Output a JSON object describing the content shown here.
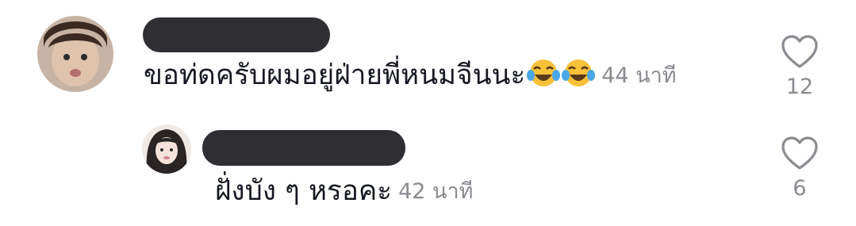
{
  "comments": [
    {
      "text": "ขอท่ดครับผมอยู่ฝ่ายพี่หนมจีนนะ",
      "emoji": "face-with-tears-of-joy x2",
      "time": "44 นาที",
      "likes": "12"
    },
    {
      "text": "ฝั่งบัง ๆ หรอคะ",
      "time": "42 นาที",
      "likes": "6"
    }
  ],
  "colors": {
    "text": "#161823",
    "muted": "#8a8b91",
    "redaction": "#2e2e33"
  }
}
